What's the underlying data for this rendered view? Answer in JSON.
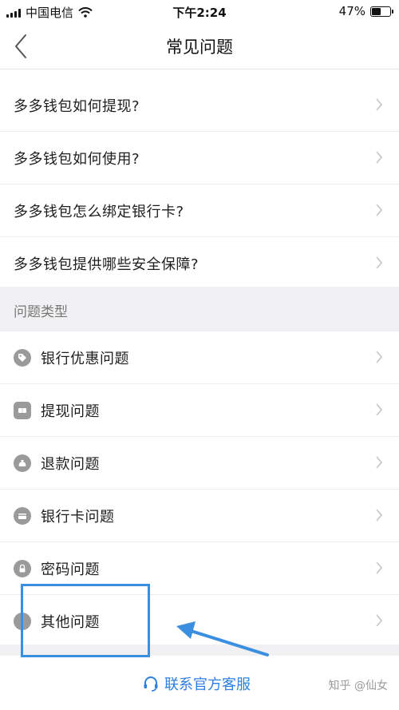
{
  "status_bar": {
    "carrier": "中国电信",
    "time": "下午2:24",
    "battery": "47%",
    "battery_level": 0.47
  },
  "nav": {
    "title": "常见问题"
  },
  "faq_items": [
    {
      "label": "多多钱包如何提现?"
    },
    {
      "label": "多多钱包如何使用?"
    },
    {
      "label": "多多钱包怎么绑定银行卡?"
    },
    {
      "label": "多多钱包提供哪些安全保障?"
    }
  ],
  "section": {
    "title": "问题类型"
  },
  "categories": [
    {
      "label": "银行优惠问题",
      "icon": "tag-icon"
    },
    {
      "label": "提现问题",
      "icon": "ticket-icon"
    },
    {
      "label": "退款问题",
      "icon": "money-bag-icon"
    },
    {
      "label": "银行卡问题",
      "icon": "card-icon"
    },
    {
      "label": "密码问题",
      "icon": "lock-icon"
    },
    {
      "label": "其他问题",
      "icon": "info-icon"
    }
  ],
  "contact": {
    "label": "联系官方客服",
    "icon": "headset-icon"
  },
  "watermark": "知乎 @仙女",
  "colors": {
    "accent": "#2f7fe0",
    "annotation": "#3b8fe0",
    "icon_gray": "#9a9a9a",
    "section_bg": "#f1f1f3"
  }
}
